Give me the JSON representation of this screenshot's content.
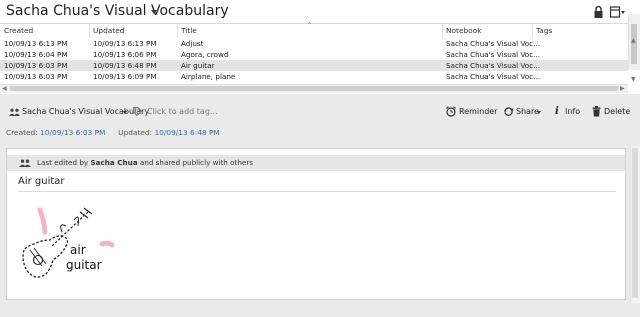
{
  "window": {
    "notebook_title": "Sacha Chua's Visual Vocabulary",
    "icons": [
      "lock-icon",
      "view-options-icon"
    ]
  },
  "list": {
    "columns": [
      "Created",
      "Updated",
      "Title",
      "Notebook",
      "Tags"
    ],
    "rows": [
      {
        "created": "10/09/13 6:13 PM",
        "updated": "10/09/13 6:13 PM",
        "title": "Adjust",
        "notebook": "Sacha Chua's Visual Voc...",
        "tags": "",
        "selected": false
      },
      {
        "created": "10/09/13 6:04 PM",
        "updated": "10/09/13 6:06 PM",
        "title": "Agora, crowd",
        "notebook": "Sacha Chua's Visual Voc...",
        "tags": "",
        "selected": false
      },
      {
        "created": "10/09/13 6:03 PM",
        "updated": "10/09/13 6:48 PM",
        "title": "Air guitar",
        "notebook": "Sacha Chua's Visual Voc...",
        "tags": "",
        "selected": true
      },
      {
        "created": "10/09/13 6:03 PM",
        "updated": "10/09/13 6:09 PM",
        "title": "Airplane, plane",
        "notebook": "Sacha Chua's Visual Voc...",
        "tags": "",
        "selected": false
      }
    ]
  },
  "note": {
    "notebook_selector": "Sacha Chua's Visual Vocabulary",
    "tag_placeholder": "Click to add tag...",
    "toolbar": {
      "reminder": "Reminder",
      "share": "Share",
      "info": "Info",
      "delete": "Delete"
    },
    "meta": {
      "created_label": "Created:",
      "created_value": "10/09/13 6:03 PM",
      "updated_label": "Updated:",
      "updated_value": "10/09/13 6:48 PM"
    },
    "share_bar": {
      "prefix": "Last edited by",
      "author": "Sacha Chua",
      "suffix": "and shared publicly with others"
    },
    "title": "Air guitar",
    "sketch_text": [
      "air",
      "guitar"
    ]
  },
  "colors": {
    "link": "#2a6fb8",
    "selected_row": "#e3e3e3",
    "panel_bg": "#eaeaea",
    "sketch_pink": "#f4b3c6"
  }
}
